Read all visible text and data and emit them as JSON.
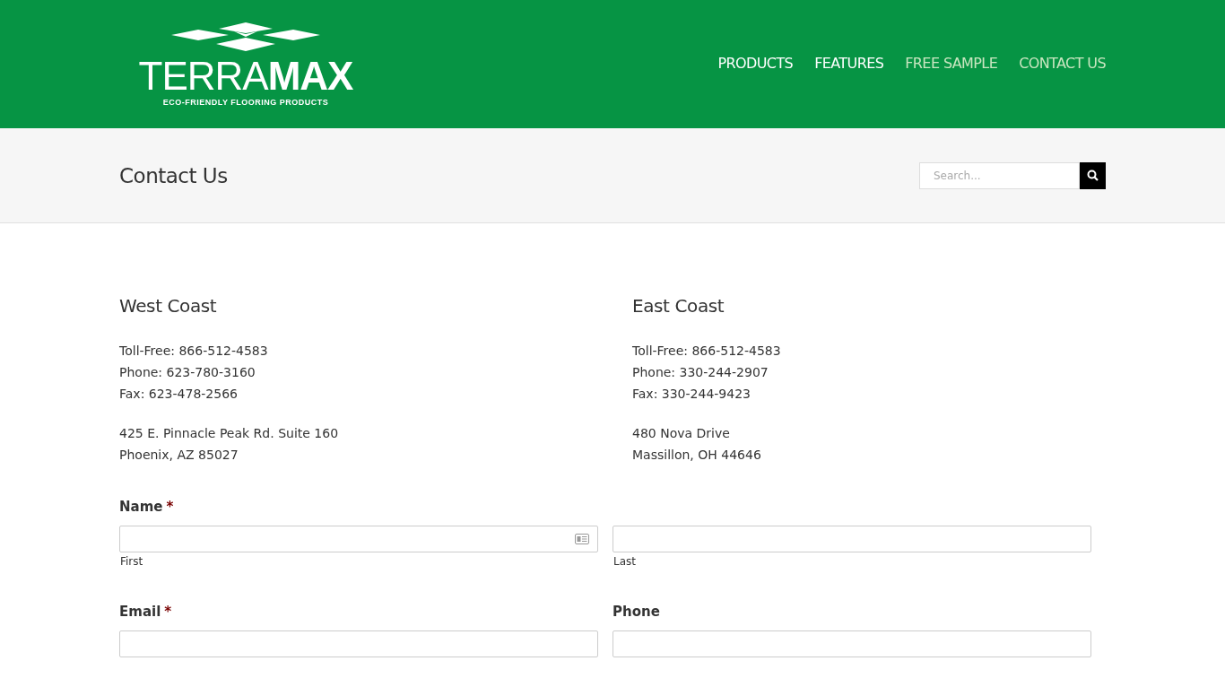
{
  "logo": {
    "word_light": "TERRA",
    "word_bold": "MAX",
    "tagline": "ECO-FRIENDLY FLOORING PRODUCTS"
  },
  "nav": [
    {
      "label": "PRODUCTS",
      "dimmed": false
    },
    {
      "label": "FEATURES",
      "dimmed": false
    },
    {
      "label": "FREE SAMPLE",
      "dimmed": true
    },
    {
      "label": "CONTACT US",
      "dimmed": true
    }
  ],
  "page_title": "Contact Us",
  "search": {
    "placeholder": "Search..."
  },
  "offices": [
    {
      "heading": "West Coast",
      "lines": [
        "Toll-Free: 866-512-4583",
        "Phone: 623-780-3160",
        "Fax: 623-478-2566"
      ],
      "address": [
        "425 E. Pinnacle Peak Rd. Suite 160",
        "Phoenix, AZ 85027"
      ]
    },
    {
      "heading": "East Coast",
      "lines": [
        "Toll-Free: 866-512-4583",
        "Phone: 330-244-2907",
        "Fax: 330-244-9423"
      ],
      "address": [
        "480 Nova Drive",
        "Massillon, OH 44646"
      ]
    }
  ],
  "form": {
    "rows": [
      {
        "kind": "split",
        "label": "Name",
        "required": true,
        "fields": [
          {
            "sublabel": "First",
            "contact_icon": true
          },
          {
            "sublabel": "Last",
            "contact_icon": false
          }
        ]
      },
      {
        "kind": "pair",
        "items": [
          {
            "label": "Email",
            "required": true
          },
          {
            "label": "Phone",
            "required": false
          }
        ]
      }
    ],
    "required_mark": "*"
  }
}
